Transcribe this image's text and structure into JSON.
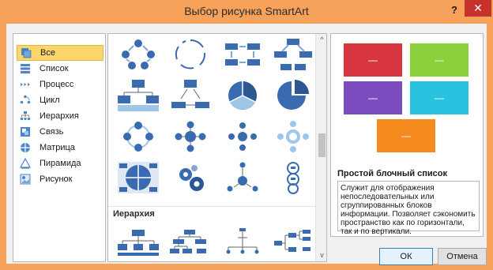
{
  "window": {
    "title": "Выбор рисунка SmartArt",
    "help_label": "?",
    "close_label": "✕"
  },
  "categories": [
    {
      "label": "Все",
      "icon": "all-icon",
      "selected": true
    },
    {
      "label": "Список",
      "icon": "list-icon"
    },
    {
      "label": "Процесс",
      "icon": "process-icon"
    },
    {
      "label": "Цикл",
      "icon": "cycle-icon"
    },
    {
      "label": "Иерархия",
      "icon": "hierarchy-icon"
    },
    {
      "label": "Связь",
      "icon": "relationship-icon"
    },
    {
      "label": "Матрица",
      "icon": "matrix-icon"
    },
    {
      "label": "Пирамида",
      "icon": "pyramid-icon"
    },
    {
      "label": "Рисунок",
      "icon": "picture-icon"
    }
  ],
  "gallery": {
    "section_header": "Иерархия",
    "scroll_up": "^",
    "scroll_down": "v"
  },
  "preview": {
    "title": "Простой блочный список",
    "description": "Служит для отображения непоследовательных или сгруппированных блоков информации. Позволяет сэкономить пространство как по горизонтали, так и по вертикали.",
    "block_label": "—",
    "colors": [
      "#d7363f",
      "#8bd13c",
      "#7b4bc0",
      "#29c3e0",
      "#f58a1f"
    ]
  },
  "buttons": {
    "ok": "ОК",
    "cancel": "Отмена"
  },
  "colors": {
    "titlebar": "#f6a25a",
    "close": "#c7312b",
    "selection": "#fbd66b",
    "shape_blue": "#3a6bb0"
  }
}
